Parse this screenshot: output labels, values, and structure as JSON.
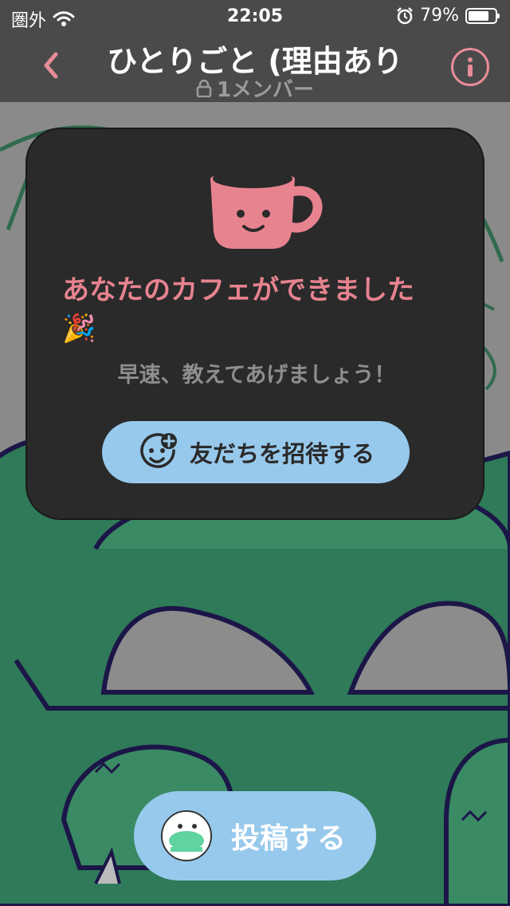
{
  "status_bar": {
    "carrier": "圏外",
    "time": "22:05",
    "battery_percent": "79%",
    "battery_level": 0.79
  },
  "header": {
    "title": "ひとりごと (理由あり",
    "member_count": "1メンバー",
    "accent_color": "#e88c98"
  },
  "modal": {
    "title_line1": "あなたのカフェができました",
    "title_line2": "🎉",
    "subtitle": "早速、教えてあげましょう！",
    "invite_label": "友だちを招待する",
    "button_color": "#97c9ec"
  },
  "footer": {
    "post_label": "投稿する"
  }
}
